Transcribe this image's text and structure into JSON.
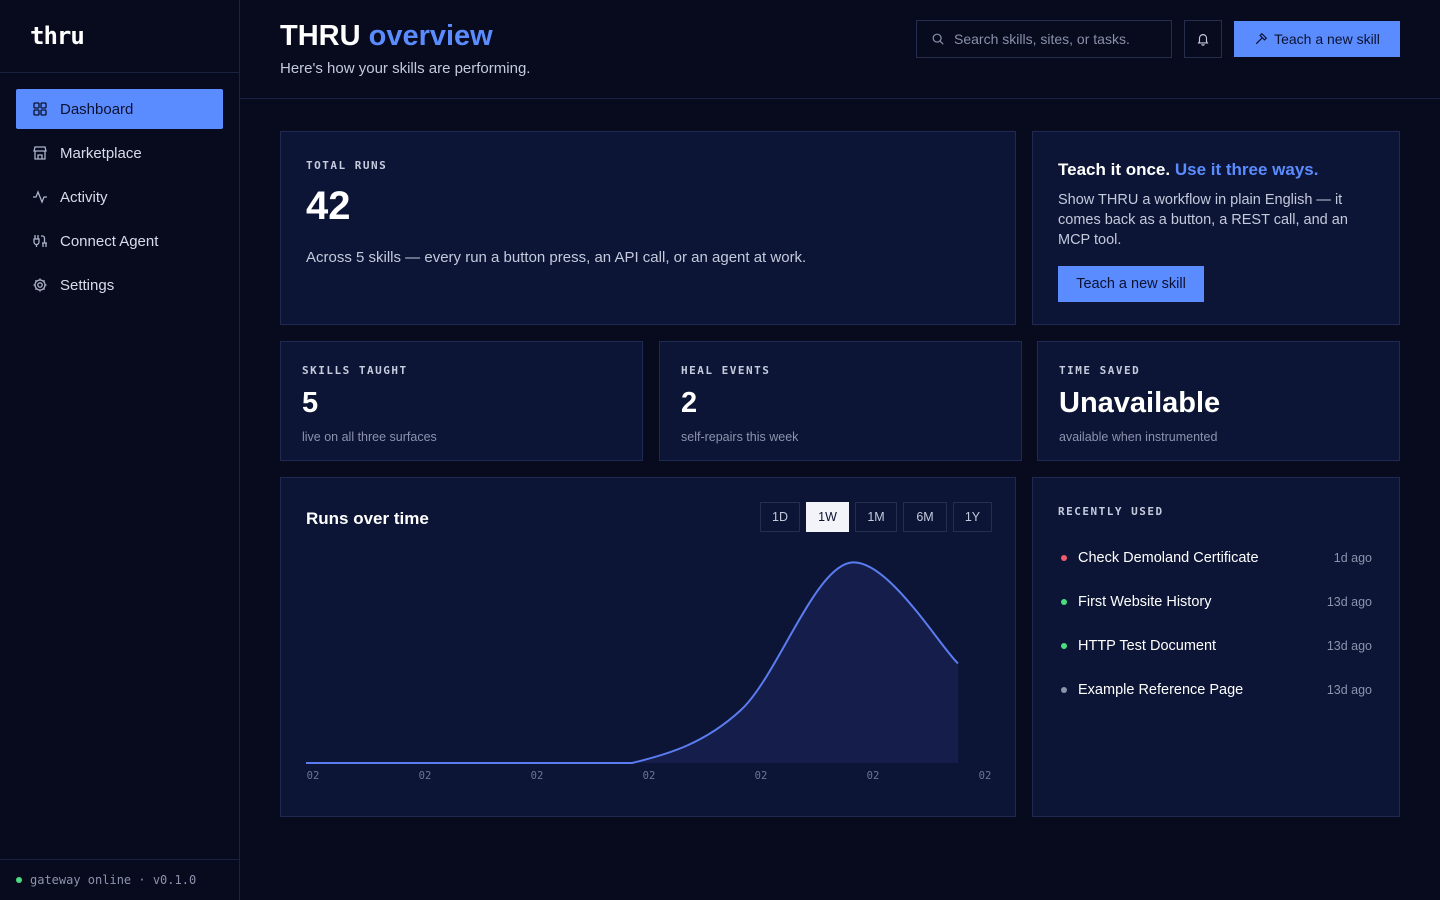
{
  "brand": {
    "logo_text": "thru"
  },
  "sidebar": {
    "items": [
      {
        "label": "Dashboard",
        "icon": "grid-icon",
        "active": true
      },
      {
        "label": "Marketplace",
        "icon": "store-icon",
        "active": false
      },
      {
        "label": "Activity",
        "icon": "activity-icon",
        "active": false
      },
      {
        "label": "Connect Agent",
        "icon": "plug-icon",
        "active": false
      },
      {
        "label": "Settings",
        "icon": "gear-icon",
        "active": false
      }
    ],
    "footer": {
      "status_text": "gateway online · v0.1.0",
      "status_color": "#4ade80"
    }
  },
  "header": {
    "title_main": "THRU",
    "title_accent": "overview",
    "subtitle": "Here's how your skills are performing.",
    "search_placeholder": "Search skills, sites, or tasks.",
    "teach_button": "Teach a new skill"
  },
  "total_runs": {
    "label": "TOTAL RUNS",
    "value": "42",
    "description": "Across 5 skills — every run a button press, an API call, or an agent at work."
  },
  "promo": {
    "title_main": "Teach it once.",
    "title_accent": "Use it three ways.",
    "text": "Show THRU a workflow in plain English — it comes back as a button, a REST call, and an MCP tool.",
    "button": "Teach a new skill"
  },
  "stats": [
    {
      "label": "SKILLS TAUGHT",
      "value": "5",
      "sub": "live on all three surfaces"
    },
    {
      "label": "HEAL EVENTS",
      "value": "2",
      "sub": "self-repairs this week"
    },
    {
      "label": "TIME SAVED",
      "value": "Unavailable",
      "sub": "available when instrumented"
    }
  ],
  "chart": {
    "title": "Runs over time",
    "ranges": [
      {
        "label": "1D",
        "active": false
      },
      {
        "label": "1W",
        "active": true
      },
      {
        "label": "1M",
        "active": false
      },
      {
        "label": "6M",
        "active": false
      },
      {
        "label": "1Y",
        "active": false
      }
    ]
  },
  "chart_data": {
    "type": "area",
    "x": [
      "02",
      "02",
      "02",
      "02",
      "02",
      "02",
      "02"
    ],
    "series": [
      {
        "values": [
          0,
          0,
          0,
          0,
          5.4,
          20.5,
          10.2
        ]
      }
    ],
    "ylim": [
      0,
      21
    ],
    "grid": false,
    "line_color": "#5b7cf0",
    "fill_color": "#151d4a"
  },
  "recent": {
    "label": "RECENTLY USED",
    "items": [
      {
        "name": "Check Demoland Certificate",
        "time": "1d ago",
        "status_color": "#f05a6e"
      },
      {
        "name": "First Website History",
        "time": "13d ago",
        "status_color": "#4ade80"
      },
      {
        "name": "HTTP Test Document",
        "time": "13d ago",
        "status_color": "#4ade80"
      },
      {
        "name": "Example Reference Page",
        "time": "13d ago",
        "status_color": "#8d93ad"
      }
    ]
  }
}
